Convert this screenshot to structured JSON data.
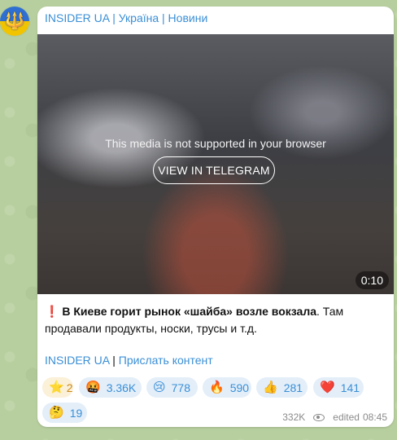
{
  "channel": {
    "name": "INSIDER UA | Україна | Новини",
    "avatar_icon": "trident-icon"
  },
  "media": {
    "message": "This media is not supported in your browser",
    "button_label": "VIEW IN TELEGRAM",
    "duration": "0:10"
  },
  "post": {
    "exclamation": "❗",
    "headline": "В Киеве горит рынок «шайба» возле вокзала",
    "body": ". Там продавали продукты, носки, трусы и т.д."
  },
  "links": {
    "insider": "INSIDER UA",
    "separator": " | ",
    "submit": "Прислать контент"
  },
  "reactions": [
    {
      "emoji": "⭐",
      "count": "2"
    },
    {
      "emoji": "🤬",
      "count": "3.36K"
    },
    {
      "emoji": "😢",
      "count": "778"
    },
    {
      "emoji": "🔥",
      "count": "590"
    },
    {
      "emoji": "👍",
      "count": "281"
    },
    {
      "emoji": "❤️",
      "count": "141"
    },
    {
      "emoji": "🤔",
      "count": "19"
    }
  ],
  "meta": {
    "views": "332K",
    "edited": "edited",
    "time": "08:45"
  },
  "colors": {
    "link": "#3a8fd6",
    "reaction_bg": "#e3eef9",
    "star_bg": "#fbf0d8"
  }
}
